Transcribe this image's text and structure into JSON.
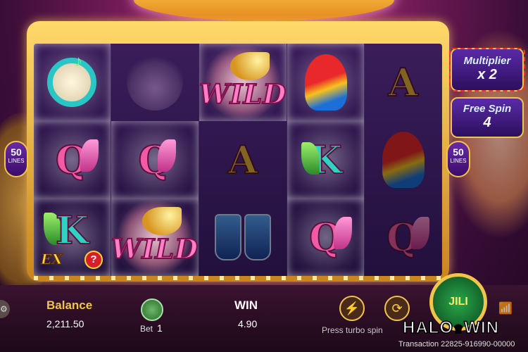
{
  "reels": [
    [
      "tambourine",
      "headdress",
      "wild",
      "parrot",
      "A"
    ],
    [
      "Q",
      "Q",
      "A",
      "K",
      "parrot"
    ],
    [
      "K",
      "wild",
      "drums",
      "Q",
      "Q"
    ]
  ],
  "symbols": {
    "wild_text": "WILD",
    "q": "Q",
    "k": "K",
    "a": "A",
    "ex": "EX",
    "help": "?"
  },
  "lines": {
    "left_count": "50",
    "left_label": "LINES",
    "right_count": "50",
    "right_label": "LINES"
  },
  "multiplier": {
    "label": "Multiplier",
    "value": "x 2"
  },
  "free_spin": {
    "label": "Free Spin",
    "value": "4"
  },
  "balance": {
    "label": "Balance",
    "value": "2,211.50"
  },
  "bet": {
    "label": "Bet",
    "value": "1"
  },
  "win": {
    "label": "WIN",
    "value": "4.90"
  },
  "turbo": {
    "label": "Press turbo spin"
  },
  "spin_button": {
    "brand": "JILI"
  },
  "logo": {
    "text_left": "HALO",
    "text_right": "WIN"
  },
  "transaction": {
    "text": "Transaction 22825-916990-00000"
  },
  "colors": {
    "accent": "#f0c54a",
    "wild": "#ff7fc6",
    "q": "#f25aa5",
    "k": "#2fd3c3",
    "a": "#e8b63a"
  }
}
